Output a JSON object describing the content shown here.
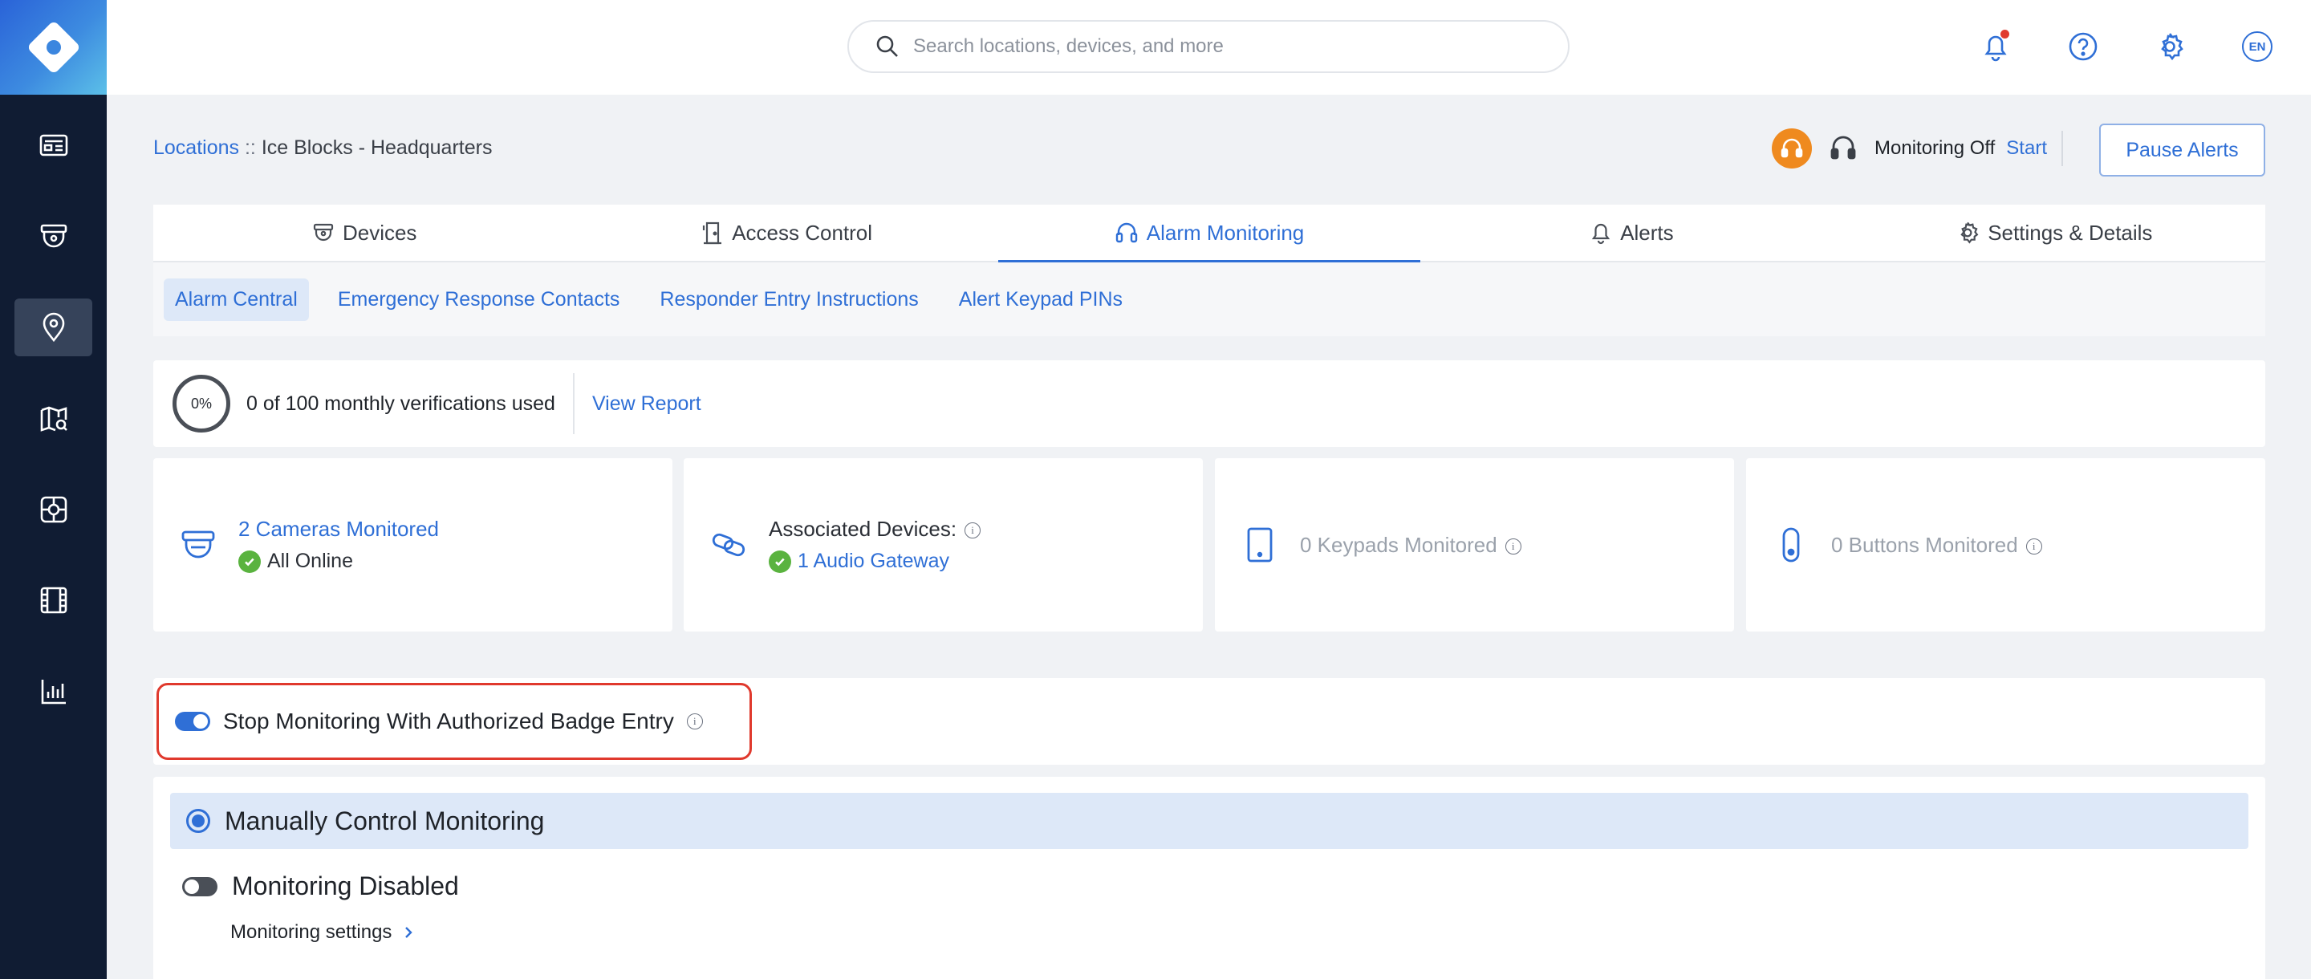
{
  "topbar": {
    "search_placeholder": "Search locations, devices, and more",
    "language": "EN"
  },
  "colors": {
    "accent": "#2f6fd6",
    "sidebar": "#101c33",
    "highlight_border": "#e0392d",
    "success": "#5ab33f",
    "monitoring_badge": "#ef8a1f"
  },
  "sidebar": {
    "items": [
      {
        "icon": "dashboard-icon"
      },
      {
        "icon": "camera-icon"
      },
      {
        "icon": "location-pin-icon",
        "active": true
      },
      {
        "icon": "map-search-icon"
      },
      {
        "icon": "access-icon"
      },
      {
        "icon": "film-icon"
      },
      {
        "icon": "analytics-icon"
      }
    ]
  },
  "breadcrumb": {
    "link": "Locations",
    "separator": " :: ",
    "current": "Ice Blocks - Headquarters"
  },
  "monitoring": {
    "status": "Monitoring Off",
    "start_label": "Start",
    "pause_label": "Pause Alerts"
  },
  "tabs": [
    {
      "label": "Devices",
      "icon": "camera-icon"
    },
    {
      "label": "Access Control",
      "icon": "door-icon"
    },
    {
      "label": "Alarm Monitoring",
      "icon": "headset-icon",
      "active": true
    },
    {
      "label": "Alerts",
      "icon": "bell-icon"
    },
    {
      "label": "Settings & Details",
      "icon": "gear-icon"
    }
  ],
  "subtabs": [
    {
      "label": "Alarm Central",
      "active": true
    },
    {
      "label": "Emergency Response Contacts"
    },
    {
      "label": "Responder Entry Instructions"
    },
    {
      "label": "Alert Keypad PINs"
    }
  ],
  "verifications": {
    "percent_label": "0%",
    "text": "0 of 100 monthly verifications used",
    "link": "View Report"
  },
  "cards": {
    "cameras": {
      "title": "2 Cameras Monitored",
      "status": "All Online"
    },
    "associated": {
      "title": "Associated Devices:",
      "link": "1 Audio Gateway"
    },
    "keypads": {
      "title": "0 Keypads Monitored"
    },
    "buttons": {
      "title": "0 Buttons Monitored"
    }
  },
  "badge_entry": {
    "label": "Stop Monitoring With Authorized Badge Entry",
    "enabled": true
  },
  "mode": {
    "manual_label": "Manually Control Monitoring",
    "disabled_label": "Monitoring Disabled",
    "settings_link": "Monitoring settings"
  }
}
